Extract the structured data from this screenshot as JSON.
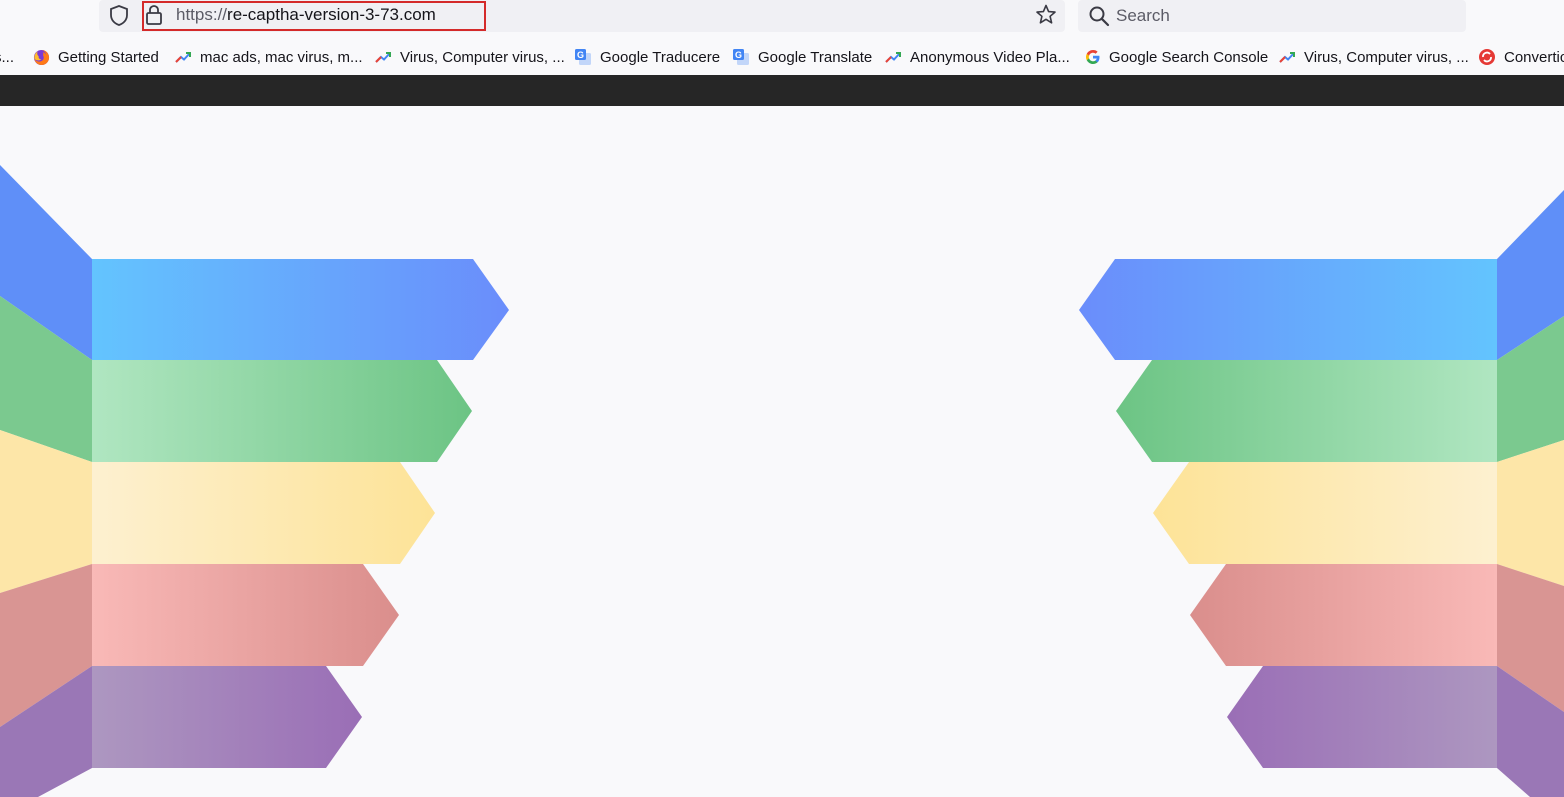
{
  "address_bar": {
    "url_scheme": "https://",
    "url_host": "re-captha-version-3-73.com"
  },
  "search_bar": {
    "placeholder": "Search"
  },
  "bookmarks": [
    {
      "label": "s...",
      "icon": "truncated"
    },
    {
      "label": "Getting Started",
      "icon": "firefox-icon"
    },
    {
      "label": "mac ads, mac virus, m...",
      "icon": "trend-icon"
    },
    {
      "label": "Virus, Computer virus, ...",
      "icon": "trend-icon"
    },
    {
      "label": "Google Traducere",
      "icon": "google-translate-icon"
    },
    {
      "label": "Google Translate",
      "icon": "google-translate-icon"
    },
    {
      "label": "Anonymous Video Pla...",
      "icon": "trend-icon"
    },
    {
      "label": "Google Search Console",
      "icon": "google-g-icon"
    },
    {
      "label": "Virus, Computer virus, ...",
      "icon": "trend-icon"
    },
    {
      "label": "Convertic",
      "icon": "red-circle-icon"
    }
  ],
  "colors": {
    "highlight_box": "#d42a2a",
    "blue_band": "#63bdfd",
    "green_band": "#79c98b",
    "yellow_band": "#fde7a2",
    "red_band": "#f2aaa8",
    "purple_band": "#a17bba",
    "dark_strip": "#262626"
  }
}
